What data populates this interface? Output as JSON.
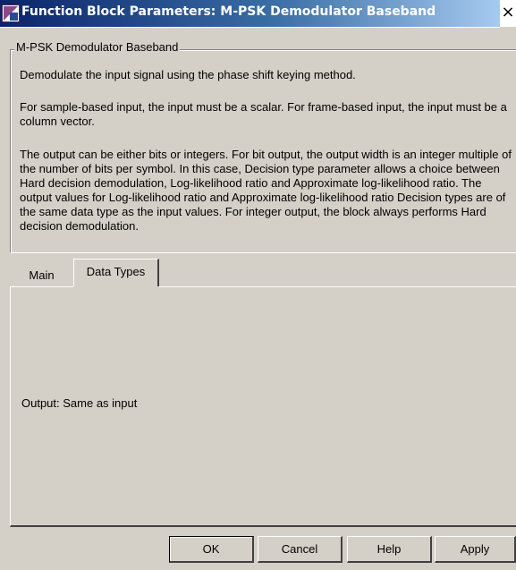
{
  "window": {
    "title": "Function Block Parameters: M-PSK Demodulator Baseband",
    "close_label": "×"
  },
  "description": {
    "group_label": "M-PSK Demodulator Baseband",
    "paragraphs": [
      "Demodulate the input signal using the phase shift keying method.",
      "For sample-based input, the input must be a scalar. For frame-based input, the input must be a column vector.",
      "The output can be either bits or integers. For bit output, the output width is an integer multiple of the number of bits per symbol. In this case, Decision type parameter allows a choice between Hard decision demodulation, Log-likelihood ratio and Approximate log-likelihood ratio. The output values for Log-likelihood ratio and Approximate log-likelihood ratio Decision types are of the same data type as the input values. For integer output, the block always performs Hard decision demodulation."
    ]
  },
  "tabs": [
    {
      "label": "Main",
      "selected": false
    },
    {
      "label": "Data Types",
      "selected": true
    }
  ],
  "data_types_panel": {
    "output_text": "Output: Same as input"
  },
  "buttons": {
    "ok": "OK",
    "cancel": "Cancel",
    "help": "Help",
    "apply": "Apply"
  },
  "colors": {
    "face": "#d4d0c8",
    "title_active": "#0a246a",
    "title_gradient_end": "#a6caf0"
  },
  "icons": {
    "title": "simulink-block-icon",
    "close": "close-icon"
  }
}
